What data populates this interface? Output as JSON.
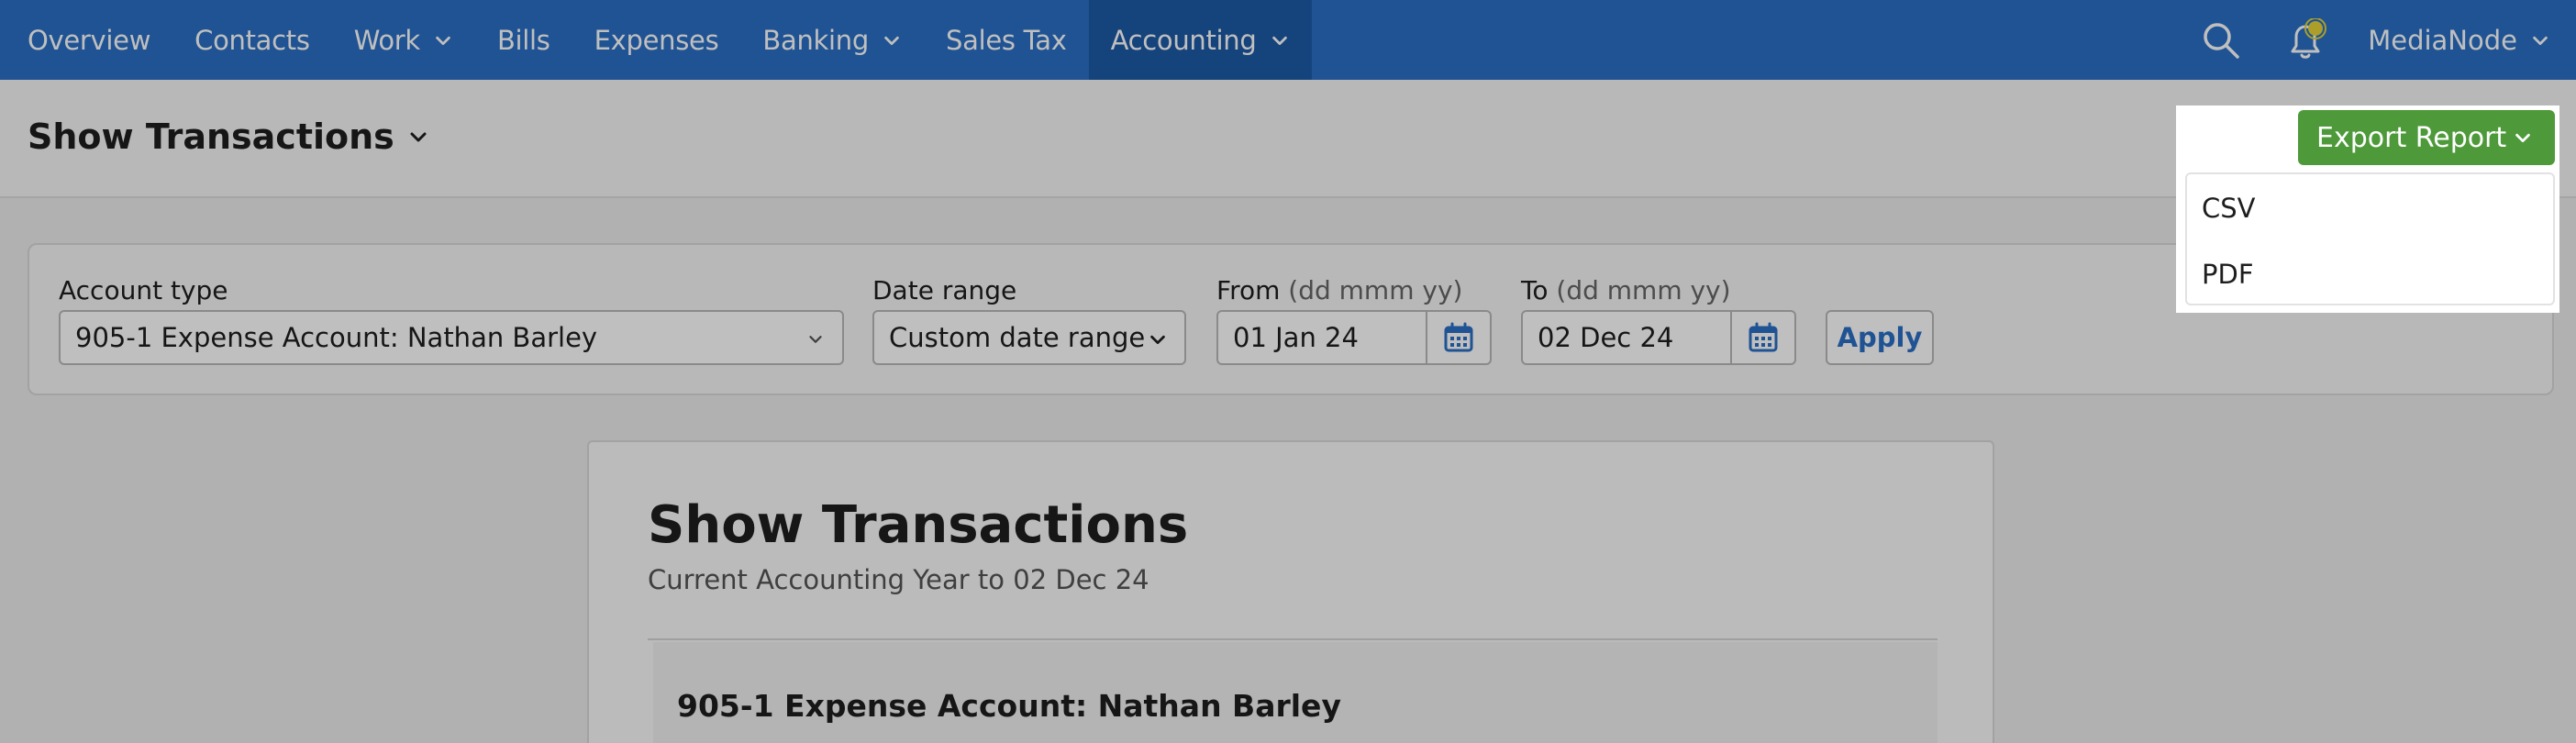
{
  "nav": {
    "items": [
      {
        "label": "Overview",
        "dropdown": false
      },
      {
        "label": "Contacts",
        "dropdown": false
      },
      {
        "label": "Work",
        "dropdown": true
      },
      {
        "label": "Bills",
        "dropdown": false
      },
      {
        "label": "Expenses",
        "dropdown": false
      },
      {
        "label": "Banking",
        "dropdown": true
      },
      {
        "label": "Sales Tax",
        "dropdown": false
      },
      {
        "label": "Accounting",
        "dropdown": true,
        "active": true
      }
    ],
    "user": "MediaNode",
    "icons": [
      "search-icon",
      "notification-bell-icon"
    ]
  },
  "header": {
    "title": "Show Transactions"
  },
  "export": {
    "button_label": "Export Report",
    "menu_items": [
      "CSV",
      "PDF"
    ]
  },
  "filters": {
    "account_type_label": "Account type",
    "account_type_value": "905-1 Expense Account: Nathan Barley",
    "date_range_label": "Date range",
    "date_range_value": "Custom date range",
    "from_label": "From",
    "from_hint": "(dd mmm yy)",
    "from_value": "01 Jan 24",
    "to_label": "To",
    "to_hint": "(dd mmm yy)",
    "to_value": "02 Dec 24",
    "apply_label": "Apply"
  },
  "report": {
    "title": "Show Transactions",
    "subtitle": "Current Accounting Year to 02 Dec 24",
    "account_heading": "905-1 Expense Account: Nathan Barley"
  },
  "colors": {
    "nav_bg": "#2a6fc4",
    "nav_active": "#1d5aa6",
    "export_green": "#4e9a3a",
    "link_blue": "#2a6fc4"
  }
}
